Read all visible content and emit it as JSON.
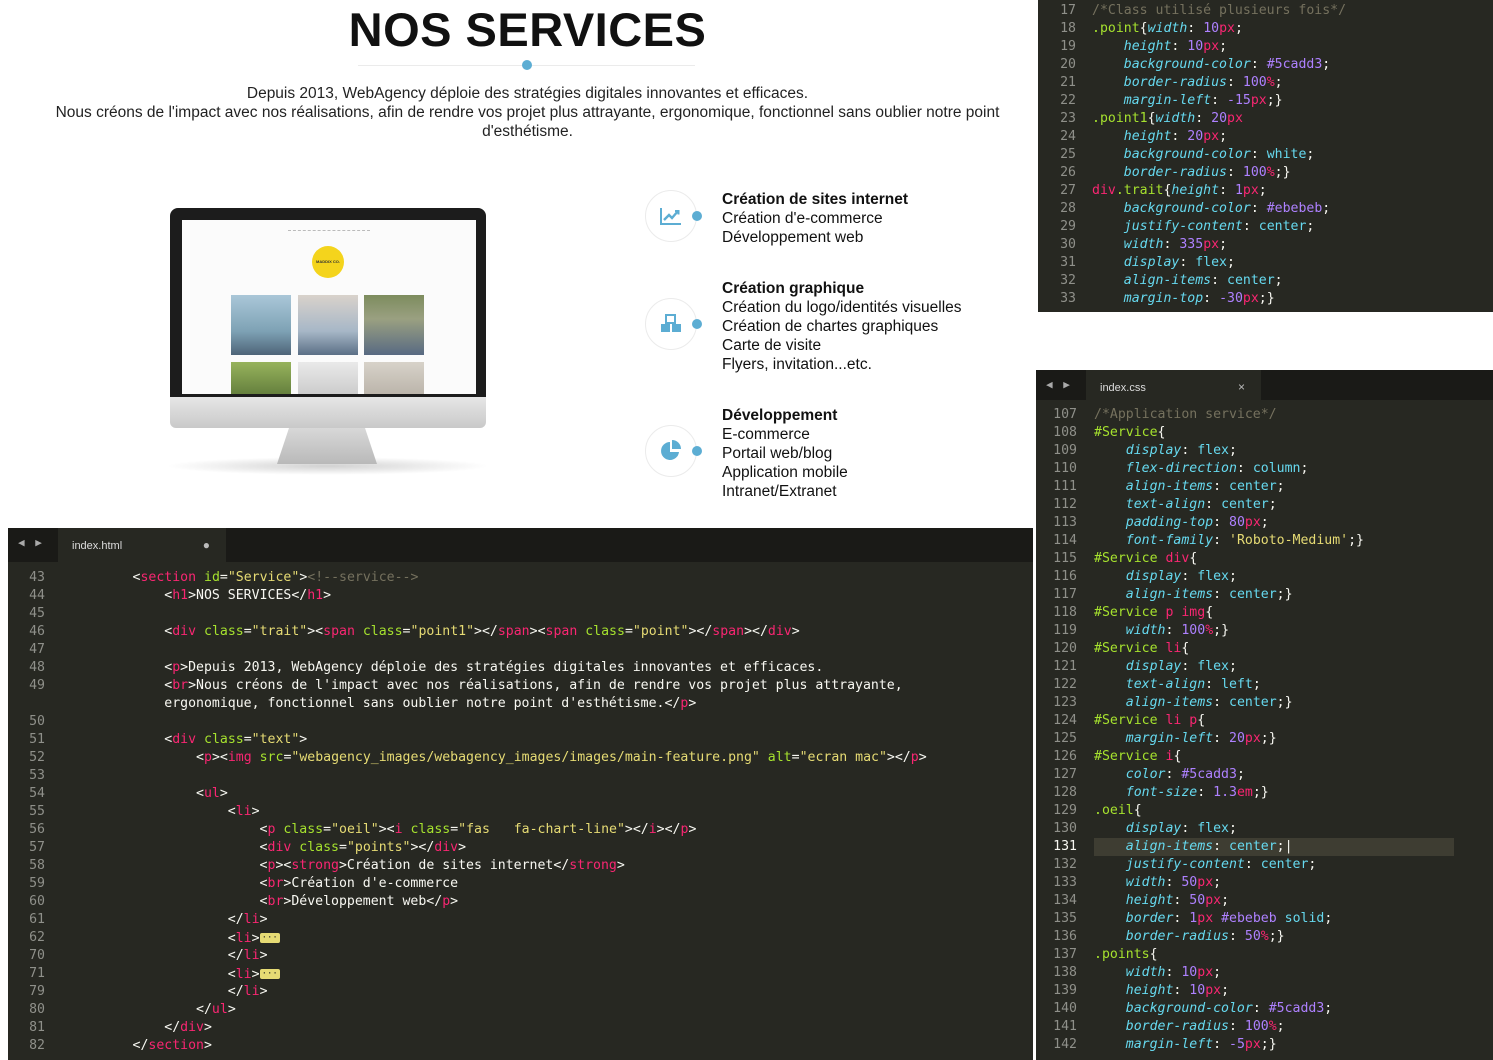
{
  "preview": {
    "title": "NOS SERVICES",
    "intro_line1": "Depuis 2013, WebAgency déploie des stratégies digitales innovantes et efficaces.",
    "intro_line2": "Nous créons de l'impact avec nos réalisations, afin de rendre vos projet plus attrayante, ergonomique, fonctionnel sans oublier notre point",
    "intro_line3": "d'esthétisme.",
    "screen_logo": "MADDIX CO.",
    "accent_color": "#5cadd3",
    "services": [
      {
        "icon": "chart-line-icon",
        "title": "Création de sites internet",
        "items": [
          "Création d'e-commerce",
          "Développement web"
        ]
      },
      {
        "icon": "cubes-icon",
        "title": "Création graphique",
        "items": [
          "Création du logo/identités visuelles",
          "Création de chartes graphiques",
          "Carte de visite",
          "Flyers, invitation...etc."
        ]
      },
      {
        "icon": "chart-pie-icon",
        "title": "Développement",
        "items": [
          "E-commerce",
          "Portail web/blog",
          "Application mobile",
          "Intranet/Extranet"
        ]
      }
    ]
  },
  "css_editor_top": {
    "lines": [
      {
        "n": "17",
        "code": "<span class=\"c-cm\">/*Class utilisé plusieurs fois*/</span>"
      },
      {
        "n": "18",
        "code": "<span class=\"c-sel\">.point</span>{<span class=\"c-prop\">width</span>: <span class=\"c-num\">10</span><span class=\"c-unit\">px</span>;"
      },
      {
        "n": "19",
        "code": "    <span class=\"c-prop\">height</span>: <span class=\"c-num\">10</span><span class=\"c-unit\">px</span>;"
      },
      {
        "n": "20",
        "code": "    <span class=\"c-prop\">background-color</span>: <span class=\"c-num\">#5cadd3</span>;"
      },
      {
        "n": "21",
        "code": "    <span class=\"c-prop\">border-radius</span>: <span class=\"c-num\">100</span><span class=\"c-unit\">%</span>;"
      },
      {
        "n": "22",
        "code": "    <span class=\"c-prop\">margin-left</span>: <span class=\"c-num\">-15</span><span class=\"c-unit\">px</span>;}"
      },
      {
        "n": "23",
        "code": "<span class=\"c-sel\">.point1</span>{<span class=\"c-prop\">width</span>: <span class=\"c-num\">20</span><span class=\"c-unit\">px</span>"
      },
      {
        "n": "24",
        "code": "    <span class=\"c-prop\">height</span>: <span class=\"c-num\">20</span><span class=\"c-unit\">px</span>;"
      },
      {
        "n": "25",
        "code": "    <span class=\"c-prop\">background-color</span>: <span class=\"c-val\">white</span>;"
      },
      {
        "n": "26",
        "code": "    <span class=\"c-prop\">border-radius</span>: <span class=\"c-num\">100</span><span class=\"c-unit\">%</span>;}"
      },
      {
        "n": "27",
        "code": "<span class=\"c-tag\">div</span><span class=\"c-sel\">.trait</span>{<span class=\"c-prop\">height</span>: <span class=\"c-num\">1</span><span class=\"c-unit\">px</span>;"
      },
      {
        "n": "28",
        "code": "    <span class=\"c-prop\">background-color</span>: <span class=\"c-num\">#ebebeb</span>;"
      },
      {
        "n": "29",
        "code": "    <span class=\"c-prop\">justify-content</span>: <span class=\"c-val\">center</span>;"
      },
      {
        "n": "30",
        "code": "    <span class=\"c-prop\">width</span>: <span class=\"c-num\">335</span><span class=\"c-unit\">px</span>;"
      },
      {
        "n": "31",
        "code": "    <span class=\"c-prop\">display</span>: <span class=\"c-val\">flex</span>;"
      },
      {
        "n": "32",
        "code": "    <span class=\"c-prop\">align-items</span>: <span class=\"c-val\">center</span>;"
      },
      {
        "n": "33",
        "code": "    <span class=\"c-prop\">margin-top</span>: <span class=\"c-num\">-30</span><span class=\"c-unit\">px</span>;}"
      }
    ]
  },
  "css_editor_bottom": {
    "tab_arrows": "◀ ▶",
    "tab_name": "index.css",
    "tab_close": "×",
    "highlight_line": "131",
    "lines": [
      {
        "n": "107",
        "code": "<span class=\"c-cm\">/*Application service*/</span>"
      },
      {
        "n": "108",
        "code": "<span class=\"c-sel\">#Service</span>{"
      },
      {
        "n": "109",
        "code": "    <span class=\"c-prop\">display</span>: <span class=\"c-val\">flex</span>;"
      },
      {
        "n": "110",
        "code": "    <span class=\"c-prop\">flex-direction</span>: <span class=\"c-val\">column</span>;"
      },
      {
        "n": "111",
        "code": "    <span class=\"c-prop\">align-items</span>: <span class=\"c-val\">center</span>;"
      },
      {
        "n": "112",
        "code": "    <span class=\"c-prop\">text-align</span>: <span class=\"c-val\">center</span>;"
      },
      {
        "n": "113",
        "code": "    <span class=\"c-prop\">padding-top</span>: <span class=\"c-num\">80</span><span class=\"c-unit\">px</span>;"
      },
      {
        "n": "114",
        "code": "    <span class=\"c-prop\">font-family</span>: <span class=\"c-str\">'Roboto-Medium'</span>;}"
      },
      {
        "n": "115",
        "code": "<span class=\"c-sel\">#Service</span> <span class=\"c-tag\">div</span>{"
      },
      {
        "n": "116",
        "code": "    <span class=\"c-prop\">display</span>: <span class=\"c-val\">flex</span>;"
      },
      {
        "n": "117",
        "code": "    <span class=\"c-prop\">align-items</span>: <span class=\"c-val\">center</span>;}"
      },
      {
        "n": "118",
        "code": "<span class=\"c-sel\">#Service</span> <span class=\"c-tag\">p img</span>{"
      },
      {
        "n": "119",
        "code": "    <span class=\"c-prop\">width</span>: <span class=\"c-num\">100</span><span class=\"c-unit\">%</span>;}"
      },
      {
        "n": "120",
        "code": "<span class=\"c-sel\">#Service</span> <span class=\"c-tag\">li</span>{"
      },
      {
        "n": "121",
        "code": "    <span class=\"c-prop\">display</span>: <span class=\"c-val\">flex</span>;"
      },
      {
        "n": "122",
        "code": "    <span class=\"c-prop\">text-align</span>: <span class=\"c-val\">left</span>;"
      },
      {
        "n": "123",
        "code": "    <span class=\"c-prop\">align-items</span>: <span class=\"c-val\">center</span>;}"
      },
      {
        "n": "124",
        "code": "<span class=\"c-sel\">#Service</span> <span class=\"c-tag\">li p</span>{"
      },
      {
        "n": "125",
        "code": "    <span class=\"c-prop\">margin-left</span>: <span class=\"c-num\">20</span><span class=\"c-unit\">px</span>;}"
      },
      {
        "n": "126",
        "code": "<span class=\"c-sel\">#Service</span> <span class=\"c-tag\">i</span>{"
      },
      {
        "n": "127",
        "code": "    <span class=\"c-prop\">color</span>: <span class=\"c-num\">#5cadd3</span>;"
      },
      {
        "n": "128",
        "code": "    <span class=\"c-prop\">font-size</span>: <span class=\"c-num\">1.3</span><span class=\"c-unit\">em</span>;}"
      },
      {
        "n": "129",
        "code": "<span class=\"c-sel\">.oeil</span>{"
      },
      {
        "n": "130",
        "code": "    <span class=\"c-prop\">display</span>: <span class=\"c-val\">flex</span>;"
      },
      {
        "n": "131",
        "code": "    <span class=\"c-prop\">align-items</span>: <span class=\"c-val\">center</span>;|"
      },
      {
        "n": "132",
        "code": "    <span class=\"c-prop\">justify-content</span>: <span class=\"c-val\">center</span>;"
      },
      {
        "n": "133",
        "code": "    <span class=\"c-prop\">width</span>: <span class=\"c-num\">50</span><span class=\"c-unit\">px</span>;"
      },
      {
        "n": "134",
        "code": "    <span class=\"c-prop\">height</span>: <span class=\"c-num\">50</span><span class=\"c-unit\">px</span>;"
      },
      {
        "n": "135",
        "code": "    <span class=\"c-prop\">border</span>: <span class=\"c-num\">1</span><span class=\"c-unit\">px</span> <span class=\"c-num\">#ebebeb</span> <span class=\"c-val\">solid</span>;"
      },
      {
        "n": "136",
        "code": "    <span class=\"c-prop\">border-radius</span>: <span class=\"c-num\">50</span><span class=\"c-unit\">%</span>;}"
      },
      {
        "n": "137",
        "code": "<span class=\"c-sel\">.points</span>{"
      },
      {
        "n": "138",
        "code": "    <span class=\"c-prop\">width</span>: <span class=\"c-num\">10</span><span class=\"c-unit\">px</span>;"
      },
      {
        "n": "139",
        "code": "    <span class=\"c-prop\">height</span>: <span class=\"c-num\">10</span><span class=\"c-unit\">px</span>;"
      },
      {
        "n": "140",
        "code": "    <span class=\"c-prop\">background-color</span>: <span class=\"c-num\">#5cadd3</span>;"
      },
      {
        "n": "141",
        "code": "    <span class=\"c-prop\">border-radius</span>: <span class=\"c-num\">100</span><span class=\"c-unit\">%</span>;"
      },
      {
        "n": "142",
        "code": "    <span class=\"c-prop\">margin-left</span>: <span class=\"c-num\">-5</span><span class=\"c-unit\">px</span>;}"
      }
    ]
  },
  "html_editor": {
    "tab_arrows": "◀ ▶",
    "tab_name": "index.html",
    "tab_mark": "●",
    "lines": [
      {
        "n": "43",
        "code": "        &lt;<span class=\"c-tag\">section</span> <span class=\"c-attr\">id</span>=<span class=\"c-str\">\"Service\"</span>&gt;<span class=\"c-cm\">&lt;!--service--&gt;</span>"
      },
      {
        "n": "44",
        "code": "            &lt;<span class=\"c-tag\">h1</span>&gt;NOS SERVICES&lt;/<span class=\"c-tag\">h1</span>&gt;"
      },
      {
        "n": "45",
        "code": ""
      },
      {
        "n": "46",
        "code": "            &lt;<span class=\"c-tag\">div</span> <span class=\"c-attr\">class</span>=<span class=\"c-str\">\"trait\"</span>&gt;&lt;<span class=\"c-tag\">span</span> <span class=\"c-attr\">class</span>=<span class=\"c-str\">\"point1\"</span>&gt;&lt;/<span class=\"c-tag\">span</span>&gt;&lt;<span class=\"c-tag\">span</span> <span class=\"c-attr\">class</span>=<span class=\"c-str\">\"point\"</span>&gt;&lt;/<span class=\"c-tag\">span</span>&gt;&lt;/<span class=\"c-tag\">div</span>&gt;"
      },
      {
        "n": "47",
        "code": ""
      },
      {
        "n": "48",
        "code": "            &lt;<span class=\"c-tag\">p</span>&gt;Depuis 2013, WebAgency déploie des stratégies digitales innovantes et efficaces."
      },
      {
        "n": "49",
        "code": "            &lt;<span class=\"c-tag\">br</span>&gt;Nous créons de l'impact avec nos réalisations, afin de rendre vos projet plus attrayante,"
      },
      {
        "n": "",
        "code": "            ergonomique, fonctionnel sans oublier notre point d'esthétisme.&lt;/<span class=\"c-tag\">p</span>&gt;"
      },
      {
        "n": "50",
        "code": ""
      },
      {
        "n": "51",
        "code": "            &lt;<span class=\"c-tag\">div</span> <span class=\"c-attr\">class</span>=<span class=\"c-str\">\"text\"</span>&gt;"
      },
      {
        "n": "52",
        "code": "                &lt;<span class=\"c-tag\">p</span>&gt;&lt;<span class=\"c-tag\">img</span> <span class=\"c-attr\">src</span>=<span class=\"c-str\">\"webagency_images/webagency_images/images/main-feature.png\"</span> <span class=\"c-attr\">alt</span>=<span class=\"c-str\">\"ecran mac\"</span>&gt;&lt;/<span class=\"c-tag\">p</span>&gt;"
      },
      {
        "n": "53",
        "code": ""
      },
      {
        "n": "54",
        "code": "                &lt;<span class=\"c-tag\">ul</span>&gt;"
      },
      {
        "n": "55",
        "code": "                    &lt;<span class=\"c-tag\">li</span>&gt;"
      },
      {
        "n": "56",
        "code": "                        &lt;<span class=\"c-tag\">p</span> <span class=\"c-attr\">class</span>=<span class=\"c-str\">\"oeil\"</span>&gt;&lt;<span class=\"c-tag\">i</span> <span class=\"c-attr\">class</span>=<span class=\"c-str\">\"fas   fa-chart-line\"</span>&gt;&lt;/<span class=\"c-tag\">i</span>&gt;&lt;/<span class=\"c-tag\">p</span>&gt;"
      },
      {
        "n": "57",
        "code": "                        &lt;<span class=\"c-tag\">div</span> <span class=\"c-attr\">class</span>=<span class=\"c-str\">\"points\"</span>&gt;&lt;/<span class=\"c-tag\">div</span>&gt;"
      },
      {
        "n": "58",
        "code": "                        &lt;<span class=\"c-tag\">p</span>&gt;&lt;<span class=\"c-tag\">strong</span>&gt;Création de sites internet&lt;/<span class=\"c-tag\">strong</span>&gt;"
      },
      {
        "n": "59",
        "code": "                        &lt;<span class=\"c-tag\">br</span>&gt;Création d'e-commerce"
      },
      {
        "n": "60",
        "code": "                        &lt;<span class=\"c-tag\">br</span>&gt;Développement web&lt;/<span class=\"c-tag\">p</span>&gt;"
      },
      {
        "n": "61",
        "code": "                    &lt;/<span class=\"c-tag\">li</span>&gt;"
      },
      {
        "n": "62",
        "code": "                    &lt;<span class=\"c-tag\">li</span>&gt;<span class=\"c-fold\">···</span>"
      },
      {
        "n": "70",
        "code": "                    &lt;/<span class=\"c-tag\">li</span>&gt;"
      },
      {
        "n": "71",
        "code": "                    &lt;<span class=\"c-tag\">li</span>&gt;<span class=\"c-fold\">···</span>"
      },
      {
        "n": "79",
        "code": "                    &lt;/<span class=\"c-tag\">li</span>&gt;"
      },
      {
        "n": "80",
        "code": "                &lt;/<span class=\"c-tag\">ul</span>&gt;"
      },
      {
        "n": "81",
        "code": "            &lt;/<span class=\"c-tag\">div</span>&gt;"
      },
      {
        "n": "82",
        "code": "        &lt;/<span class=\"c-tag\">section</span>&gt;"
      }
    ]
  }
}
